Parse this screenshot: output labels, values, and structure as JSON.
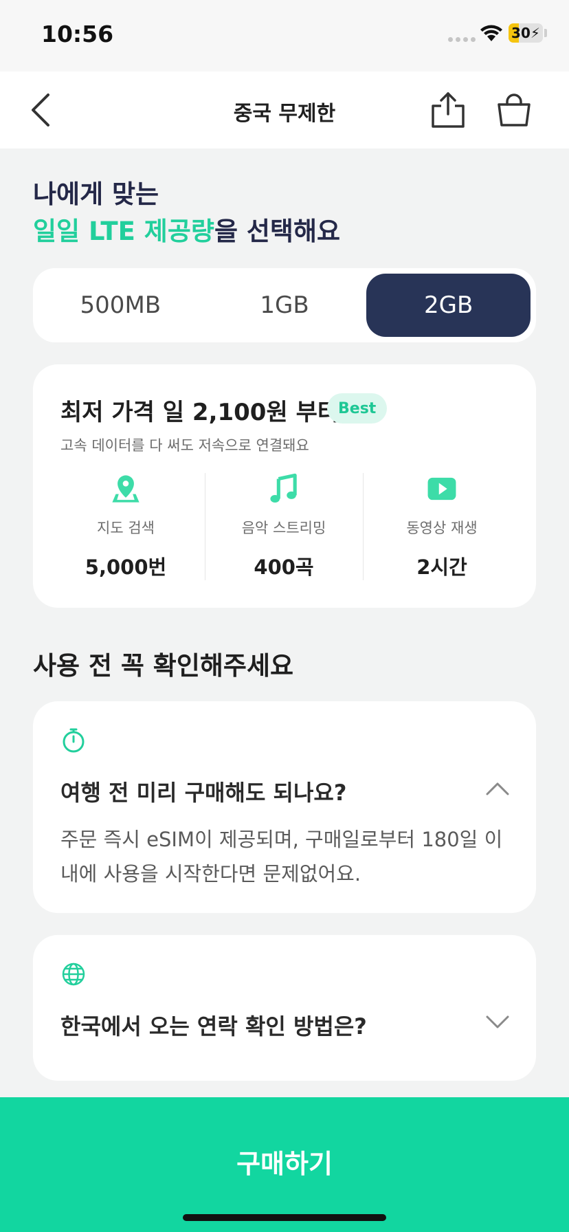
{
  "status": {
    "time": "10:56",
    "battery_text": "30",
    "battery_level": 0.3
  },
  "nav": {
    "title": "중국 무제한"
  },
  "headline": {
    "line1": "나에게 맞는",
    "accent": "일일 LTE 제공량",
    "rest": "을 선택해요"
  },
  "plans": {
    "options": [
      "500MB",
      "1GB",
      "2GB"
    ],
    "selected": "2GB"
  },
  "price_card": {
    "title": "최저 가격 일 2,100원 부터",
    "badge": "Best",
    "subtitle": "고속 데이터를 다 써도 저속으로 연결돼요",
    "features": [
      {
        "icon": "map-pin-icon",
        "label": "지도 검색",
        "value": "5,000번"
      },
      {
        "icon": "music-note-icon",
        "label": "음악 스트리밍",
        "value": "400곡"
      },
      {
        "icon": "play-video-icon",
        "label": "동영상 재생",
        "value": "2시간"
      }
    ]
  },
  "faq": {
    "section_title": "사용 전 꼭 확인해주세요",
    "items": [
      {
        "icon": "stopwatch-icon",
        "question": "여행 전 미리 구매해도 되나요?",
        "answer": "주문 즉시 eSIM이 제공되며, 구매일로부터 180일 이내에 사용을 시작한다면 문제없어요.",
        "expanded": true
      },
      {
        "icon": "globe-icon",
        "question": "한국에서 오는 연락 확인 방법은?",
        "expanded": false
      }
    ]
  },
  "buy_button": {
    "label": "구매하기"
  },
  "colors": {
    "accent": "#22cf9c",
    "navy": "#283457",
    "buy": "#12d6a0"
  }
}
